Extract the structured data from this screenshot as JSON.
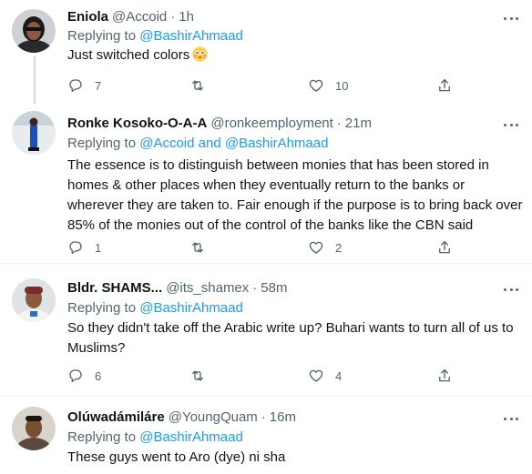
{
  "tweets": [
    {
      "name": "Eniola",
      "handle": "@Accoid",
      "time": "1h",
      "replying_prefix": "Replying to ",
      "replying_to": "@BashirAhmaad",
      "text": "Just switched colors",
      "emoji": "flushed-face-emoji",
      "replies": "7",
      "retweets": "",
      "likes": "10"
    },
    {
      "name": "Ronke Kosoko-O-A-A",
      "handle": "@ronkeemployment",
      "time": "21m",
      "replying_prefix": "Replying to ",
      "replying_to_a": "@Accoid",
      "replying_and": " and ",
      "replying_to_b": "@BashirAhmaad",
      "text": "The essence is to distinguish between monies that has been stored in homes & other places when they eventually return to the banks or wherever they are taken to.  Fair enough if the purpose is to bring back over 85% of the monies out of the control of the banks like the CBN said",
      "replies": "1",
      "retweets": "",
      "likes": "2"
    },
    {
      "name": "Bldr. SHAMS...",
      "handle": "@its_shamex",
      "time": "58m",
      "replying_prefix": "Replying to ",
      "replying_to": "@BashirAhmaad",
      "text": "So they didn't take off the Arabic write up? Buhari wants to turn all of us to Muslims?",
      "replies": "6",
      "retweets": "",
      "likes": "4"
    },
    {
      "name": "Olúwadámiláre",
      "handle": "@YoungQuam",
      "time": "16m",
      "replying_prefix": "Replying to ",
      "replying_to": "@BashirAhmaad",
      "text": "These guys went to Aro (dye) ni sha"
    }
  ],
  "meta_dot": "·",
  "icons": {
    "reply": "reply-icon",
    "retweet": "retweet-icon",
    "like": "heart-icon",
    "share": "share-icon",
    "more": "more-icon"
  },
  "colors": {
    "link": "#1d9bf0",
    "secondary": "#536471",
    "divider": "#eff3f4"
  }
}
